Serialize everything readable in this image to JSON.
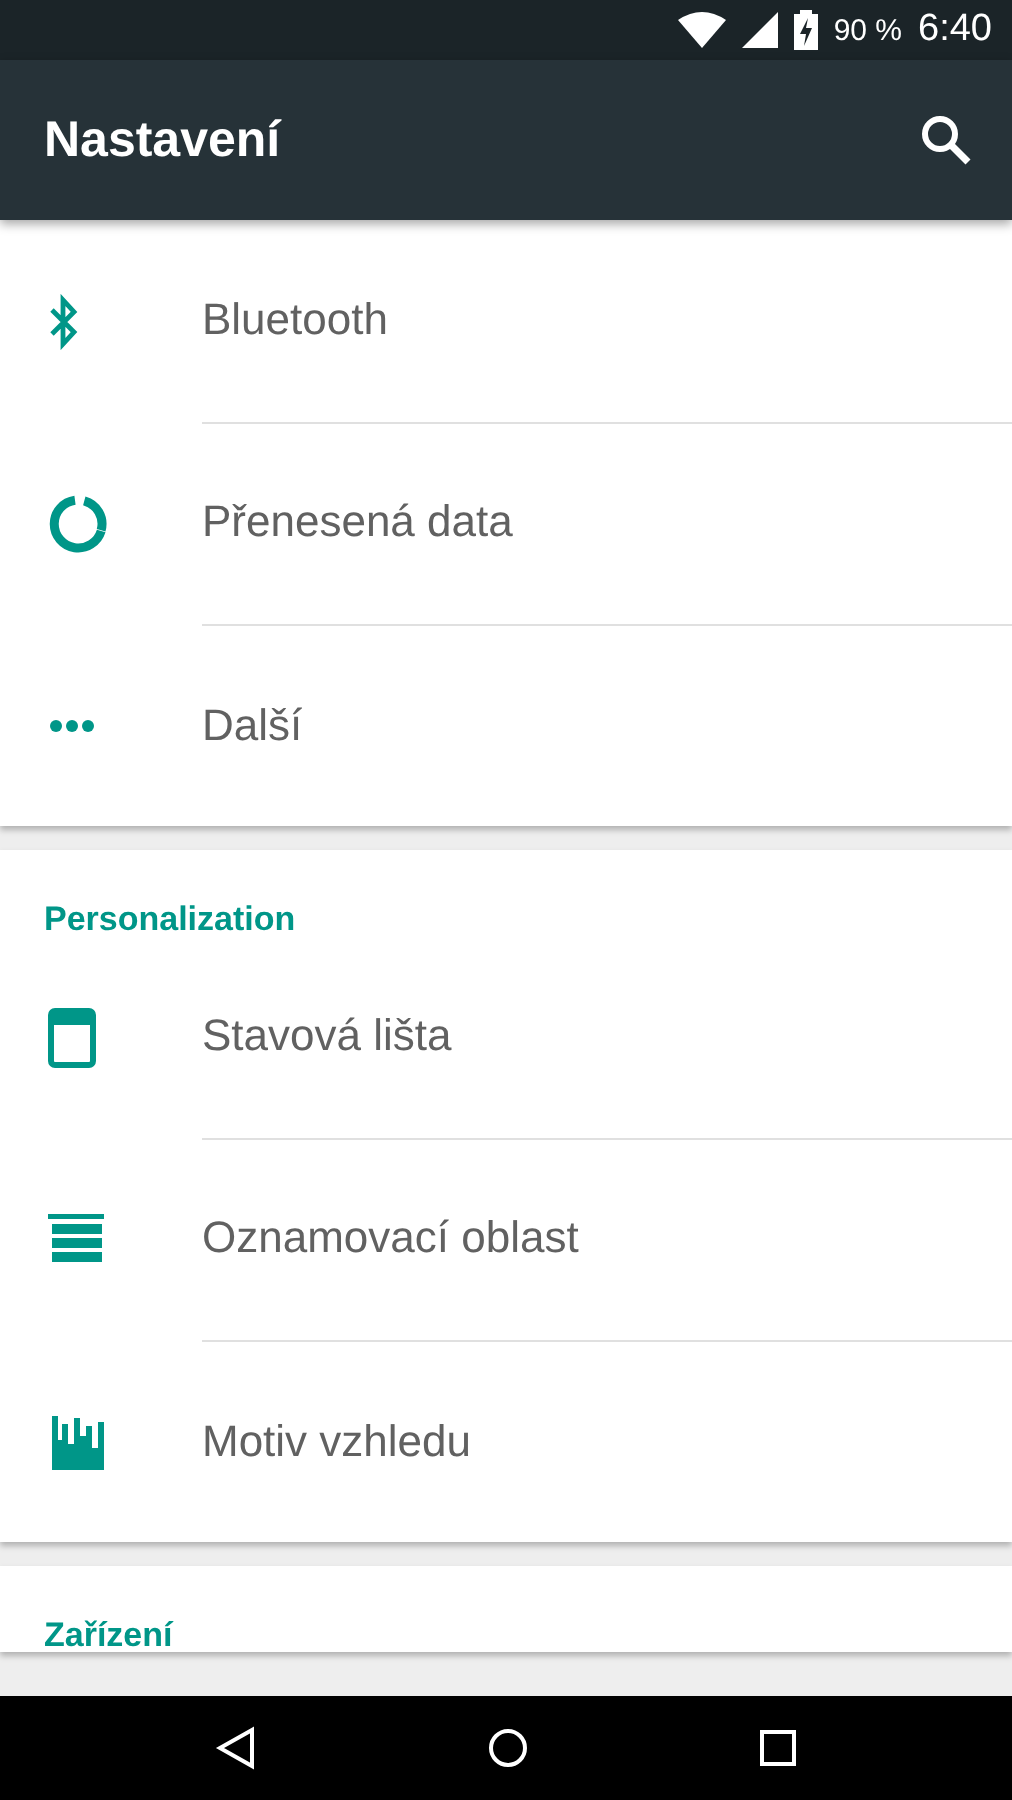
{
  "status_bar": {
    "battery": "90 %",
    "time": "6:40"
  },
  "app_bar": {
    "title": "Nastavení"
  },
  "sections": [
    {
      "items": [
        {
          "label": "Bluetooth"
        },
        {
          "label": "Přenesená data"
        },
        {
          "label": "Další"
        }
      ]
    },
    {
      "header": "Personalization",
      "items": [
        {
          "label": "Stavová lišta"
        },
        {
          "label": "Oznamovací oblast"
        },
        {
          "label": "Motiv vzhledu"
        }
      ]
    },
    {
      "header": "Zařízení"
    }
  ]
}
